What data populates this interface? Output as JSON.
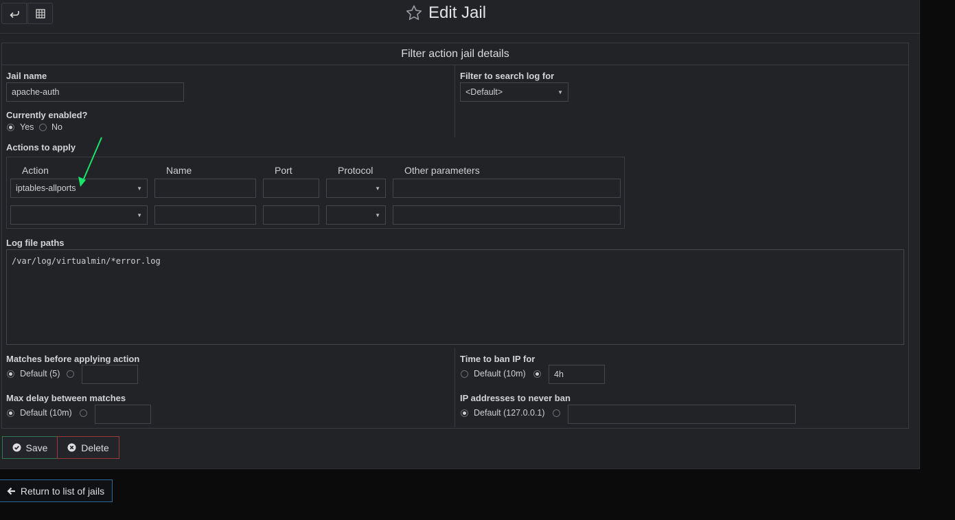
{
  "header": {
    "back_icon": "undo-arrow-icon",
    "grid_icon": "grid-icon",
    "title": "Edit Jail",
    "title_icon": "star-outline-icon"
  },
  "section": {
    "title": "Filter action jail details"
  },
  "jail_name": {
    "label": "Jail name",
    "value": "apache-auth"
  },
  "filter": {
    "label": "Filter to search log for",
    "value": "<Default>"
  },
  "enabled": {
    "label": "Currently enabled?",
    "yes": "Yes",
    "no": "No",
    "selected": "Yes"
  },
  "actions": {
    "label": "Actions to apply",
    "headers": [
      "Action",
      "Name",
      "Port",
      "Protocol",
      "Other parameters"
    ],
    "rows": [
      {
        "action": "iptables-allports",
        "name": "",
        "port": "",
        "protocol": "",
        "other": ""
      },
      {
        "action": "",
        "name": "",
        "port": "",
        "protocol": "",
        "other": ""
      }
    ]
  },
  "logs": {
    "label": "Log file paths",
    "value": "/var/log/virtualmin/*error.log"
  },
  "matches": {
    "label": "Matches before applying action",
    "default_label": "Default (5)",
    "value": ""
  },
  "ban_time": {
    "label": "Time to ban IP for",
    "default_label": "Default (10m)",
    "value": "4h"
  },
  "max_delay": {
    "label": "Max delay between matches",
    "default_label": "Default (10m)",
    "value": ""
  },
  "never_ban": {
    "label": "IP addresses to never ban",
    "default_label": "Default (127.0.0.1)",
    "value": ""
  },
  "buttons": {
    "save": "Save",
    "delete": "Delete",
    "return": "Return to list of jails"
  },
  "colors": {
    "annotation_arrow": "#19e36a",
    "save_border": "#2f7a53",
    "delete_border": "#9a3a3a",
    "return_border": "#2f6a9a"
  }
}
